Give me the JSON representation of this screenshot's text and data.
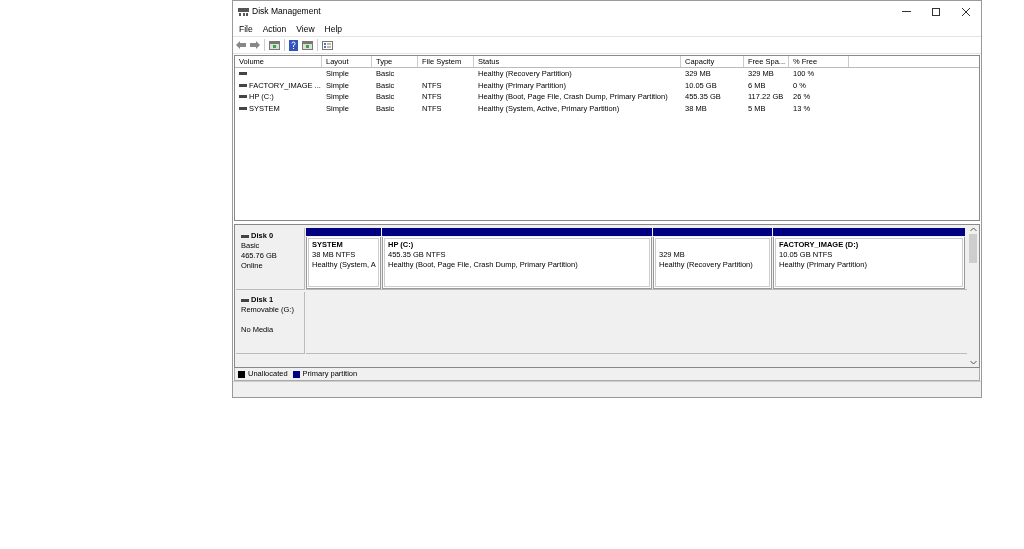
{
  "window": {
    "title": "Disk Management"
  },
  "menu": [
    "File",
    "Action",
    "View",
    "Help"
  ],
  "table": {
    "columns": [
      "Volume",
      "Layout",
      "Type",
      "File System",
      "Status",
      "Capacity",
      "Free Spa...",
      "% Free"
    ],
    "rows": [
      [
        "",
        "Simple",
        "Basic",
        "",
        "Healthy (Recovery Partition)",
        "329 MB",
        "329 MB",
        "100 %"
      ],
      [
        "FACTORY_IMAGE ...",
        "Simple",
        "Basic",
        "NTFS",
        "Healthy (Primary Partition)",
        "10.05 GB",
        "6 MB",
        "0 %"
      ],
      [
        "HP (C:)",
        "Simple",
        "Basic",
        "NTFS",
        "Healthy (Boot, Page File, Crash Dump, Primary Partition)",
        "455.35 GB",
        "117.22 GB",
        "26 %"
      ],
      [
        "SYSTEM",
        "Simple",
        "Basic",
        "NTFS",
        "Healthy (System, Active, Primary Partition)",
        "38 MB",
        "5 MB",
        "13 %"
      ]
    ]
  },
  "disks": [
    {
      "name": "Disk 0",
      "lines": [
        "Basic",
        "465.76 GB"
      ],
      "status": "Online",
      "partitions": [
        {
          "name": "SYSTEM",
          "size": "38 MB NTFS",
          "status": "Healthy (System, A"
        },
        {
          "name": "HP  (C:)",
          "size": "455.35 GB NTFS",
          "status": "Healthy (Boot, Page File, Crash Dump, Primary Partition)"
        },
        {
          "size": "329 MB",
          "status": "Healthy (Recovery Partition)"
        },
        {
          "name": "FACTORY_IMAGE  (D:)",
          "size": "10.05 GB NTFS",
          "status": "Healthy (Primary Partition)"
        }
      ]
    },
    {
      "name": "Disk 1",
      "lines": [
        "Removable (G:)"
      ],
      "status": "No Media"
    }
  ],
  "legend": [
    {
      "label": "Unallocated",
      "color": "#000000"
    },
    {
      "label": "Primary partition",
      "color": "#000080"
    }
  ]
}
